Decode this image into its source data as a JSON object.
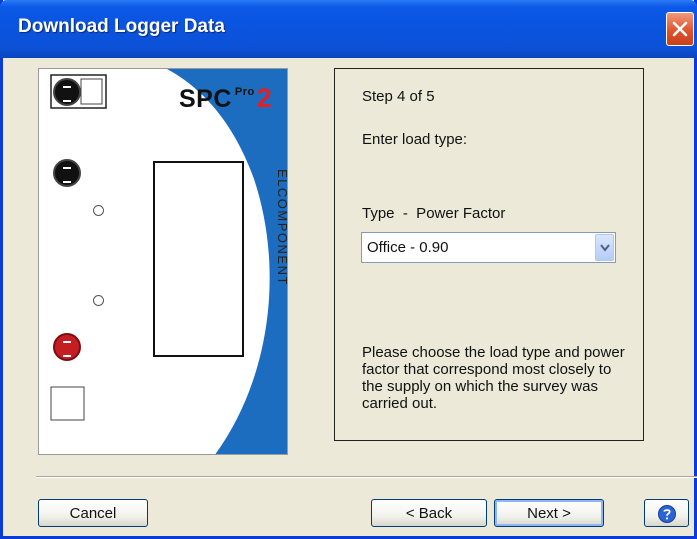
{
  "window": {
    "title": "Download Logger Data"
  },
  "device": {
    "brand_name": "SPC",
    "brand_pro": "Pro",
    "brand_number": "2",
    "vendor": "ELCOMPONENT"
  },
  "wizard": {
    "step": "Step 4 of 5",
    "prompt": "Enter load type:",
    "field_label": "Type  -  Power Factor",
    "selected_value": "Office - 0.90",
    "help_text": "Please choose the load type and power factor that correspond most closely to the supply on which the survey was carried out."
  },
  "buttons": {
    "cancel": "Cancel",
    "back": "< Back",
    "next": "Next >"
  },
  "colors": {
    "title_bar": "#0A54DF",
    "device_blue": "#1C6CC0",
    "brand_accent": "#E31E24"
  }
}
